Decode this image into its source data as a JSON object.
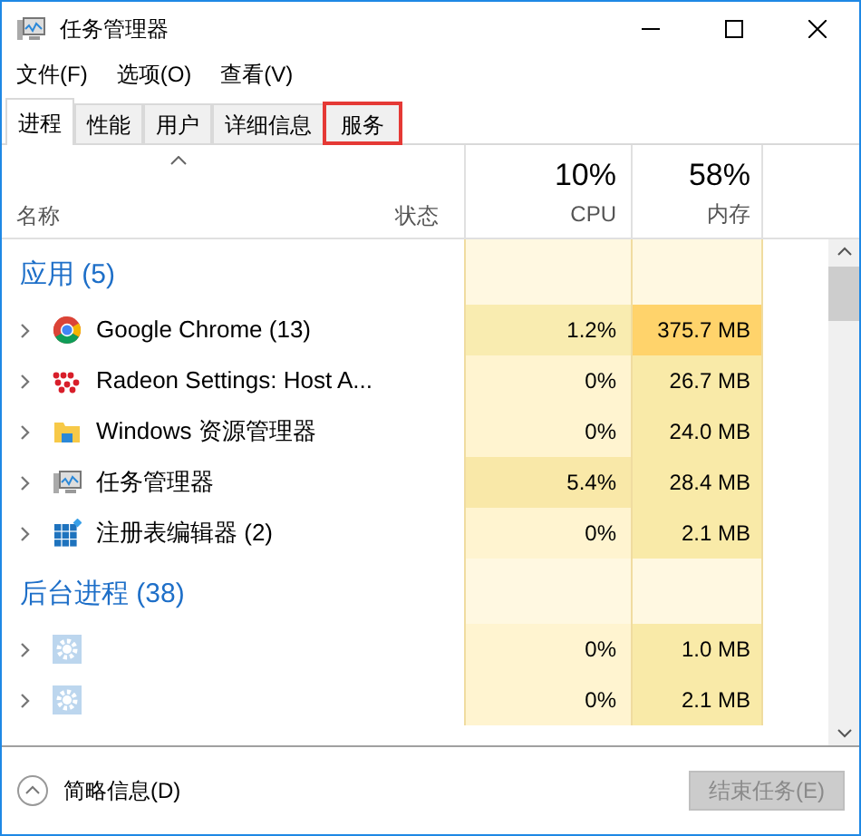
{
  "window": {
    "title": "任务管理器"
  },
  "menu": [
    "文件(F)",
    "选项(O)",
    "查看(V)"
  ],
  "tabs": [
    {
      "label": "进程",
      "selected": true,
      "highlighted": false
    },
    {
      "label": "性能",
      "selected": false,
      "highlighted": false
    },
    {
      "label": "用户",
      "selected": false,
      "highlighted": false
    },
    {
      "label": "详细信息",
      "selected": false,
      "highlighted": false
    },
    {
      "label": "服务",
      "selected": false,
      "highlighted": true
    }
  ],
  "columns": {
    "name": "名称",
    "status": "状态",
    "cpu": {
      "total": "10%",
      "label": "CPU"
    },
    "memory": {
      "total": "58%",
      "label": "内存"
    }
  },
  "groups": [
    {
      "title": "应用 (5)",
      "processes": [
        {
          "kind": "chrome",
          "name": "Google Chrome (13)",
          "cpu": {
            "text": "1.2%",
            "color": "#f9ecb0"
          },
          "memory": {
            "text": "375.7 MB",
            "color": "#ffd36b"
          }
        },
        {
          "kind": "radeon",
          "name": "Radeon Settings: Host A...",
          "cpu": {
            "text": "0%",
            "color": "#fff4d0"
          },
          "memory": {
            "text": "26.7 MB",
            "color": "#f9eaa8"
          }
        },
        {
          "kind": "folder",
          "name": "Windows 资源管理器",
          "cpu": {
            "text": "0%",
            "color": "#fff4d0"
          },
          "memory": {
            "text": "24.0 MB",
            "color": "#f9eaa8"
          }
        },
        {
          "kind": "monitor",
          "name": "任务管理器",
          "cpu": {
            "text": "5.4%",
            "color": "#f9e8a8"
          },
          "memory": {
            "text": "28.4 MB",
            "color": "#f9eaa8"
          }
        },
        {
          "kind": "registry",
          "name": "注册表编辑器 (2)",
          "cpu": {
            "text": "0%",
            "color": "#fff4d0"
          },
          "memory": {
            "text": "2.1 MB",
            "color": "#f9eaa8"
          }
        }
      ]
    },
    {
      "title": "后台进程 (38)",
      "processes": [
        {
          "kind": "gear",
          "cpu": {
            "text": "0%",
            "color": "#fff4d0"
          },
          "memory": {
            "text": "1.0 MB",
            "color": "#f9eaa8"
          }
        },
        {
          "kind": "gear",
          "cpu": {
            "text": "0%",
            "color": "#fff4d0"
          },
          "memory": {
            "text": "2.1 MB",
            "color": "#f9eaa8"
          }
        }
      ]
    }
  ],
  "footer": {
    "details": "简略信息(D)",
    "end_task": {
      "label": "结束任务(E)",
      "disabled": true
    }
  }
}
